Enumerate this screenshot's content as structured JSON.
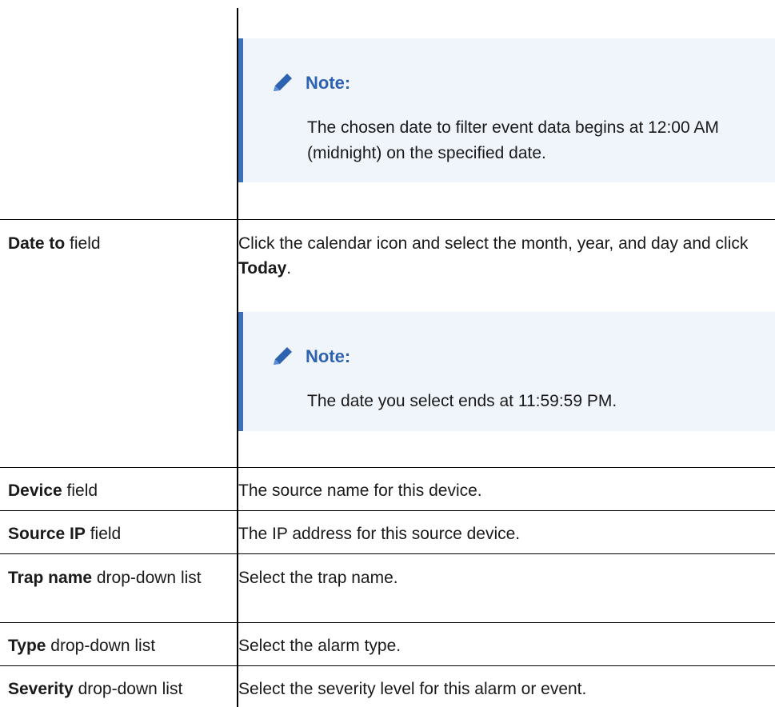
{
  "colors": {
    "note_border": "#3c6fb6",
    "note_bg": "#f0f4fb",
    "note_title": "#2e63b1"
  },
  "icons": {
    "note": "pencil-icon"
  },
  "note1": {
    "title": "Note:",
    "body": "The chosen date to filter event data begins at 12:00 AM (midnight) on the specified date."
  },
  "note2": {
    "title": "Note:",
    "body": "The date you select ends at 11:59:59 PM."
  },
  "rows": {
    "date_to": {
      "label_bold": "Date to",
      "label_rest": " field",
      "desc_pre": "Click the calendar icon and select the month, year, and day and click ",
      "desc_bold": "Today",
      "desc_post": "."
    },
    "device": {
      "label_bold": "Device",
      "label_rest": " field",
      "desc": "The source name for this device."
    },
    "source_ip": {
      "label_bold": "Source IP",
      "label_rest": " field",
      "desc": "The IP address for this source device."
    },
    "trap_name": {
      "label_bold": "Trap name",
      "label_rest": " drop-down list",
      "desc": "Select the trap name."
    },
    "type": {
      "label_bold": "Type",
      "label_rest": " drop-down list",
      "desc": "Select the alarm type."
    },
    "severity": {
      "label_bold": "Severity",
      "label_rest": " drop-down list",
      "desc": "Select the severity level for this alarm or event."
    }
  }
}
